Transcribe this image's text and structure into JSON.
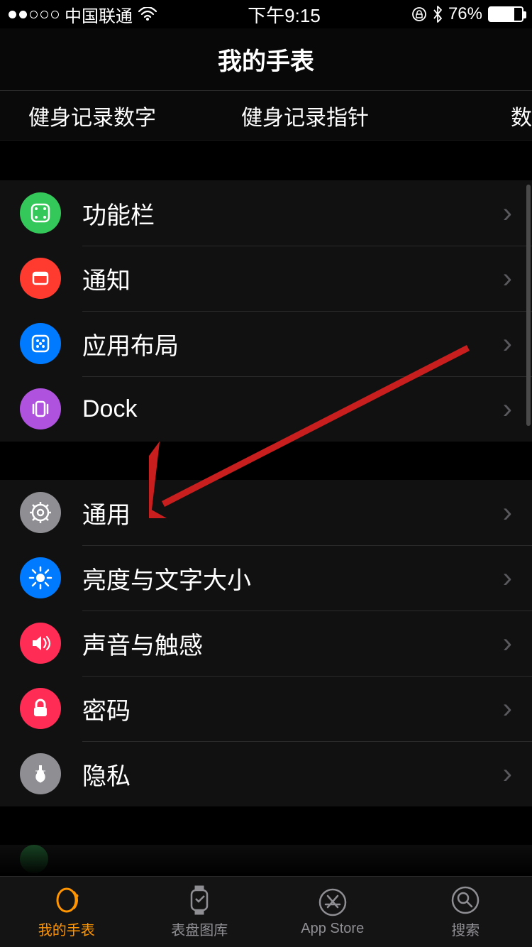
{
  "status": {
    "carrier": "中国联通",
    "time": "下午9:15",
    "battery_pct": "76%"
  },
  "title": "我的手表",
  "faces": {
    "item1": "健身记录数字",
    "item2": "健身记录指针",
    "item3_cut": "数"
  },
  "group1": [
    {
      "label": "功能栏",
      "icon": "complications-icon",
      "bg": "#34c759"
    },
    {
      "label": "通知",
      "icon": "notifications-icon",
      "bg": "#ff3b30"
    },
    {
      "label": "应用布局",
      "icon": "app-layout-icon",
      "bg": "#007aff"
    },
    {
      "label": "Dock",
      "icon": "dock-icon",
      "bg": "#af52de"
    }
  ],
  "group2": [
    {
      "label": "通用",
      "icon": "general-icon",
      "bg": "#8e8e93"
    },
    {
      "label": "亮度与文字大小",
      "icon": "brightness-icon",
      "bg": "#007aff"
    },
    {
      "label": "声音与触感",
      "icon": "sounds-icon",
      "bg": "#ff2d55"
    },
    {
      "label": "密码",
      "icon": "passcode-icon",
      "bg": "#ff2d55"
    },
    {
      "label": "隐私",
      "icon": "privacy-icon",
      "bg": "#8e8e93"
    }
  ],
  "tabs": [
    {
      "label": "我的手表",
      "name": "tab-my-watch",
      "active": true
    },
    {
      "label": "表盘图库",
      "name": "tab-face-gallery",
      "active": false
    },
    {
      "label": "App Store",
      "name": "tab-app-store",
      "active": false
    },
    {
      "label": "搜索",
      "name": "tab-search",
      "active": false
    }
  ],
  "colors": {
    "accent": "#ff9500",
    "arrow": "#c81e1e"
  }
}
